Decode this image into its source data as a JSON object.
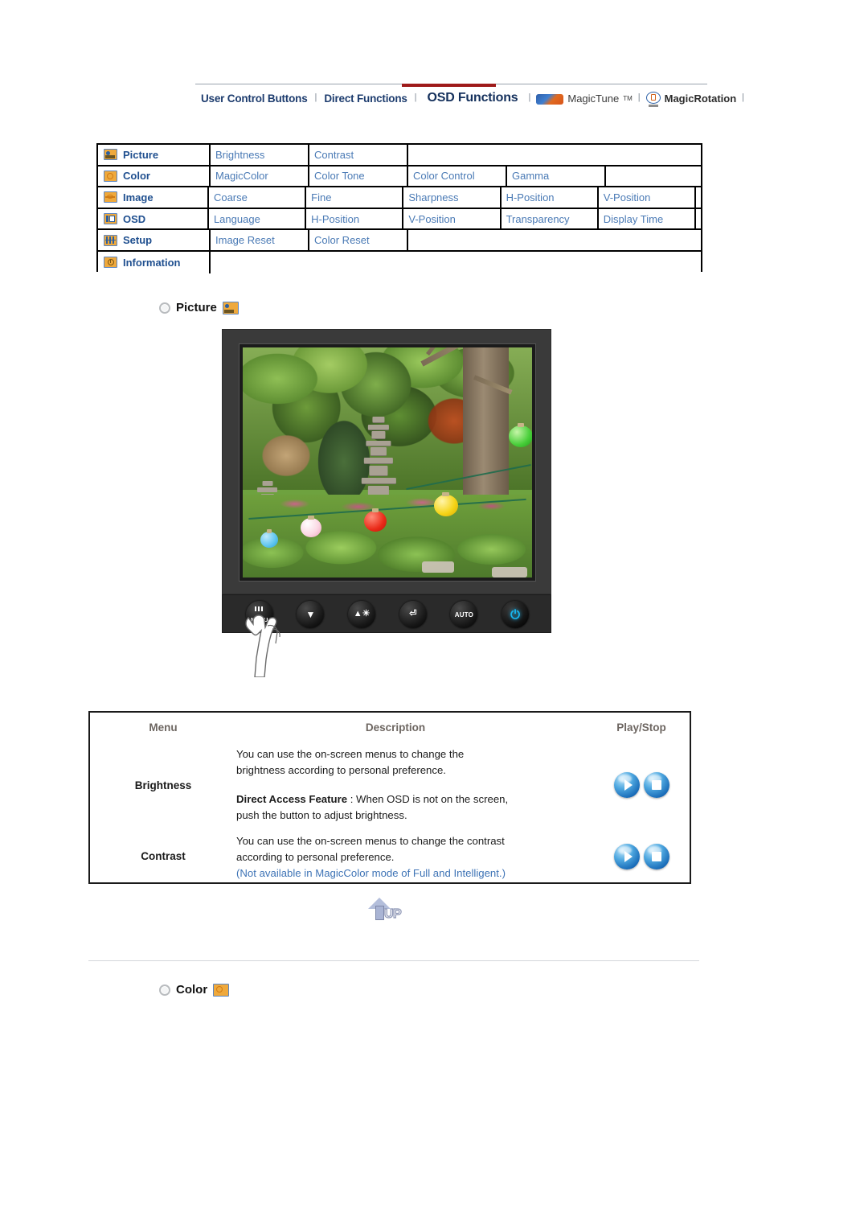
{
  "nav": {
    "items": [
      {
        "label": "User Control Buttons",
        "active": false,
        "type": "link"
      },
      {
        "label": "Direct Functions",
        "active": false,
        "type": "link"
      },
      {
        "label": "OSD Functions",
        "active": true,
        "type": "link"
      },
      {
        "label": "MagicTune",
        "active": false,
        "type": "product",
        "icon": "magictune-logo-icon",
        "superscript": "TM"
      },
      {
        "label": "MagicRotation",
        "active": false,
        "type": "product",
        "icon": "magicrotation-logo-icon"
      }
    ],
    "separator": "|",
    "active_bar_color": "#9e1a1a",
    "link_color": "#1d3c6e"
  },
  "menu_map": {
    "rows": [
      {
        "category": "Picture",
        "icon": "picture-icon",
        "items": [
          "Brightness",
          "Contrast"
        ]
      },
      {
        "category": "Color",
        "icon": "color-icon",
        "items": [
          "MagicColor",
          "Color Tone",
          "Color Control",
          "Gamma"
        ]
      },
      {
        "category": "Image",
        "icon": "image-icon",
        "items": [
          "Coarse",
          "Fine",
          "Sharpness",
          "H-Position",
          "V-Position"
        ]
      },
      {
        "category": "OSD",
        "icon": "osd-icon",
        "items": [
          "Language",
          "H-Position",
          "V-Position",
          "Transparency",
          "Display Time"
        ]
      },
      {
        "category": "Setup",
        "icon": "setup-icon",
        "items": [
          "Image Reset",
          "Color Reset"
        ]
      },
      {
        "category": "Information",
        "icon": "information-icon",
        "items": []
      }
    ],
    "item_color": "#4a7ab5",
    "category_color": "#1f4f8f"
  },
  "picture_section": {
    "heading": "Picture",
    "icon": "picture-icon"
  },
  "monitor": {
    "buttons": [
      {
        "name": "menu-button",
        "label": "MENU",
        "glyph": "menu-bars"
      },
      {
        "name": "down-button",
        "label": "",
        "glyph": "down-arrow"
      },
      {
        "name": "brightness-button",
        "label": "",
        "glyph": "up-brightness"
      },
      {
        "name": "enter-button",
        "label": "",
        "glyph": "enter"
      },
      {
        "name": "auto-button",
        "label": "AUTO",
        "glyph": ""
      },
      {
        "name": "power-button",
        "label": "",
        "glyph": "power"
      }
    ],
    "power_led_color": "#17b6f0",
    "pointing_hand": true
  },
  "description_table": {
    "headers": {
      "menu": "Menu",
      "description": "Description",
      "playstop": "Play/Stop"
    },
    "rows": [
      {
        "menu": "Brightness",
        "lines": [
          {
            "text": "You can use the on-screen menus to change the",
            "style": "normal"
          },
          {
            "text": "brightness according to personal preference.",
            "style": "normal"
          },
          {
            "text": "",
            "style": "gap"
          },
          {
            "text": "Direct Access Feature",
            "style": "bold-lead",
            "rest": " : When OSD is not on the screen,"
          },
          {
            "text": "push the button to adjust brightness.",
            "style": "normal"
          }
        ],
        "play_label": "play",
        "stop_label": "stop"
      },
      {
        "menu": "Contrast",
        "lines": [
          {
            "text": "You can use the on-screen menus to change the contrast",
            "style": "normal"
          },
          {
            "text": "according to personal preference.",
            "style": "normal"
          },
          {
            "text": "(Not available in MagicColor mode of Full and Intelligent.)",
            "style": "blue"
          }
        ],
        "play_label": "play",
        "stop_label": "stop"
      }
    ],
    "header_color": "#6d6661",
    "note_color": "#3f74b6"
  },
  "up_button": {
    "label": "UP",
    "icon": "up-arrow-icon"
  },
  "color_section": {
    "heading": "Color",
    "icon": "color-icon"
  }
}
